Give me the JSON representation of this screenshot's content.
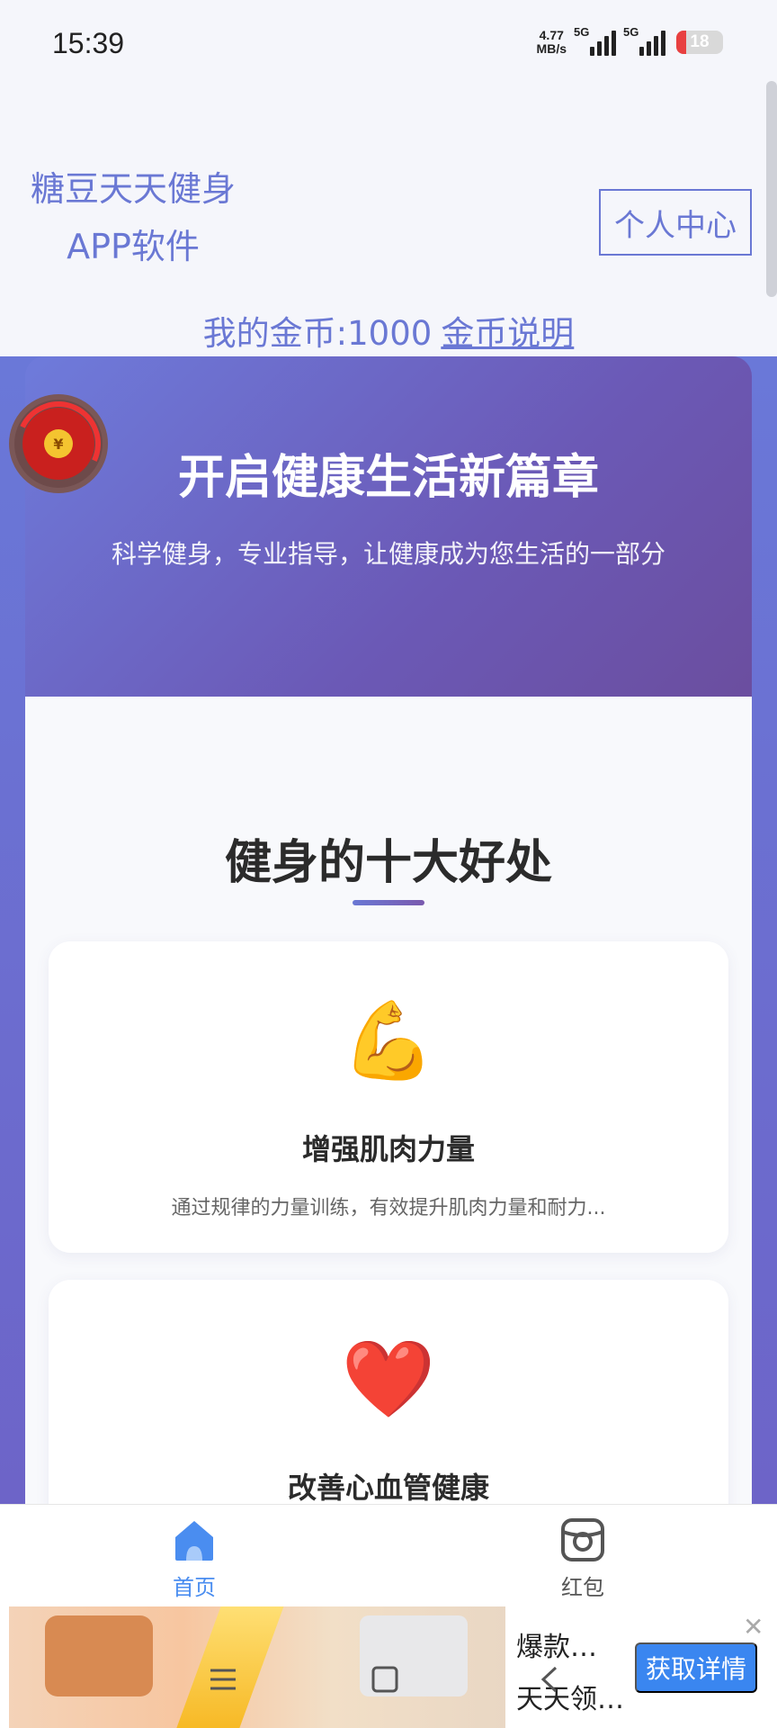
{
  "status_bar": {
    "time": "15:39",
    "net_speed_value": "4.77",
    "net_speed_unit": "MB/s",
    "signal1_label": "5G",
    "signal2_label": "5G",
    "battery": "18"
  },
  "header": {
    "app_title_line1": "糖豆天天健身",
    "app_title_line2": "APP软件",
    "profile_button": "个人中心",
    "coins_text": "我的金币:1000",
    "coins_link": "金币说明"
  },
  "hero": {
    "title": "开启健康生活新篇章",
    "subtitle": "科学健身，专业指导，让健康成为您生活的一部分"
  },
  "section": {
    "title": "健身的十大好处"
  },
  "cards": [
    {
      "icon": "💪",
      "icon_name": "flexed-biceps-icon",
      "title": "增强肌肉力量",
      "desc": "通过规律的力量训练，有效提升肌肉力量和耐力..."
    },
    {
      "icon": "❤️",
      "icon_name": "heart-icon",
      "title": "改善心血管健康",
      "desc": ""
    }
  ],
  "floating": {
    "coin_symbol": "¥"
  },
  "tabbar": {
    "home_label": "首页",
    "redpacket_label": "红包",
    "active_color": "#4a8df0"
  },
  "ad": {
    "text1": "爆款…",
    "text2": "天天领…",
    "button": "获取详情",
    "close": "✕"
  },
  "colors": {
    "accent": "#6a78d4",
    "hero_gradient_start": "#6e7bdb",
    "hero_gradient_end": "#6b4e9f",
    "ad_button": "#3a86f0"
  }
}
